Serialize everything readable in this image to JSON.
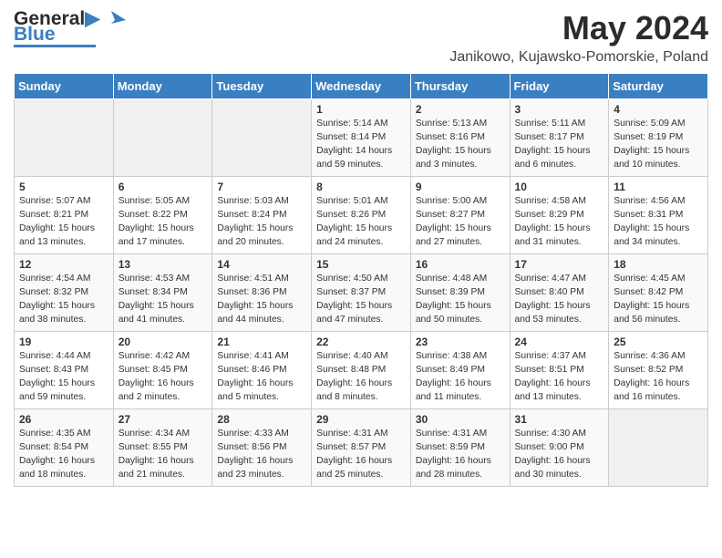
{
  "header": {
    "logo_line1": "General",
    "logo_line2": "Blue",
    "month_title": "May 2024",
    "location": "Janikowo, Kujawsko-Pomorskie, Poland"
  },
  "days_of_week": [
    "Sunday",
    "Monday",
    "Tuesday",
    "Wednesday",
    "Thursday",
    "Friday",
    "Saturday"
  ],
  "weeks": [
    [
      {
        "day": "",
        "info": ""
      },
      {
        "day": "",
        "info": ""
      },
      {
        "day": "",
        "info": ""
      },
      {
        "day": "1",
        "info": "Sunrise: 5:14 AM\nSunset: 8:14 PM\nDaylight: 14 hours\nand 59 minutes."
      },
      {
        "day": "2",
        "info": "Sunrise: 5:13 AM\nSunset: 8:16 PM\nDaylight: 15 hours\nand 3 minutes."
      },
      {
        "day": "3",
        "info": "Sunrise: 5:11 AM\nSunset: 8:17 PM\nDaylight: 15 hours\nand 6 minutes."
      },
      {
        "day": "4",
        "info": "Sunrise: 5:09 AM\nSunset: 8:19 PM\nDaylight: 15 hours\nand 10 minutes."
      }
    ],
    [
      {
        "day": "5",
        "info": "Sunrise: 5:07 AM\nSunset: 8:21 PM\nDaylight: 15 hours\nand 13 minutes."
      },
      {
        "day": "6",
        "info": "Sunrise: 5:05 AM\nSunset: 8:22 PM\nDaylight: 15 hours\nand 17 minutes."
      },
      {
        "day": "7",
        "info": "Sunrise: 5:03 AM\nSunset: 8:24 PM\nDaylight: 15 hours\nand 20 minutes."
      },
      {
        "day": "8",
        "info": "Sunrise: 5:01 AM\nSunset: 8:26 PM\nDaylight: 15 hours\nand 24 minutes."
      },
      {
        "day": "9",
        "info": "Sunrise: 5:00 AM\nSunset: 8:27 PM\nDaylight: 15 hours\nand 27 minutes."
      },
      {
        "day": "10",
        "info": "Sunrise: 4:58 AM\nSunset: 8:29 PM\nDaylight: 15 hours\nand 31 minutes."
      },
      {
        "day": "11",
        "info": "Sunrise: 4:56 AM\nSunset: 8:31 PM\nDaylight: 15 hours\nand 34 minutes."
      }
    ],
    [
      {
        "day": "12",
        "info": "Sunrise: 4:54 AM\nSunset: 8:32 PM\nDaylight: 15 hours\nand 38 minutes."
      },
      {
        "day": "13",
        "info": "Sunrise: 4:53 AM\nSunset: 8:34 PM\nDaylight: 15 hours\nand 41 minutes."
      },
      {
        "day": "14",
        "info": "Sunrise: 4:51 AM\nSunset: 8:36 PM\nDaylight: 15 hours\nand 44 minutes."
      },
      {
        "day": "15",
        "info": "Sunrise: 4:50 AM\nSunset: 8:37 PM\nDaylight: 15 hours\nand 47 minutes."
      },
      {
        "day": "16",
        "info": "Sunrise: 4:48 AM\nSunset: 8:39 PM\nDaylight: 15 hours\nand 50 minutes."
      },
      {
        "day": "17",
        "info": "Sunrise: 4:47 AM\nSunset: 8:40 PM\nDaylight: 15 hours\nand 53 minutes."
      },
      {
        "day": "18",
        "info": "Sunrise: 4:45 AM\nSunset: 8:42 PM\nDaylight: 15 hours\nand 56 minutes."
      }
    ],
    [
      {
        "day": "19",
        "info": "Sunrise: 4:44 AM\nSunset: 8:43 PM\nDaylight: 15 hours\nand 59 minutes."
      },
      {
        "day": "20",
        "info": "Sunrise: 4:42 AM\nSunset: 8:45 PM\nDaylight: 16 hours\nand 2 minutes."
      },
      {
        "day": "21",
        "info": "Sunrise: 4:41 AM\nSunset: 8:46 PM\nDaylight: 16 hours\nand 5 minutes."
      },
      {
        "day": "22",
        "info": "Sunrise: 4:40 AM\nSunset: 8:48 PM\nDaylight: 16 hours\nand 8 minutes."
      },
      {
        "day": "23",
        "info": "Sunrise: 4:38 AM\nSunset: 8:49 PM\nDaylight: 16 hours\nand 11 minutes."
      },
      {
        "day": "24",
        "info": "Sunrise: 4:37 AM\nSunset: 8:51 PM\nDaylight: 16 hours\nand 13 minutes."
      },
      {
        "day": "25",
        "info": "Sunrise: 4:36 AM\nSunset: 8:52 PM\nDaylight: 16 hours\nand 16 minutes."
      }
    ],
    [
      {
        "day": "26",
        "info": "Sunrise: 4:35 AM\nSunset: 8:54 PM\nDaylight: 16 hours\nand 18 minutes."
      },
      {
        "day": "27",
        "info": "Sunrise: 4:34 AM\nSunset: 8:55 PM\nDaylight: 16 hours\nand 21 minutes."
      },
      {
        "day": "28",
        "info": "Sunrise: 4:33 AM\nSunset: 8:56 PM\nDaylight: 16 hours\nand 23 minutes."
      },
      {
        "day": "29",
        "info": "Sunrise: 4:31 AM\nSunset: 8:57 PM\nDaylight: 16 hours\nand 25 minutes."
      },
      {
        "day": "30",
        "info": "Sunrise: 4:31 AM\nSunset: 8:59 PM\nDaylight: 16 hours\nand 28 minutes."
      },
      {
        "day": "31",
        "info": "Sunrise: 4:30 AM\nSunset: 9:00 PM\nDaylight: 16 hours\nand 30 minutes."
      },
      {
        "day": "",
        "info": ""
      }
    ]
  ]
}
